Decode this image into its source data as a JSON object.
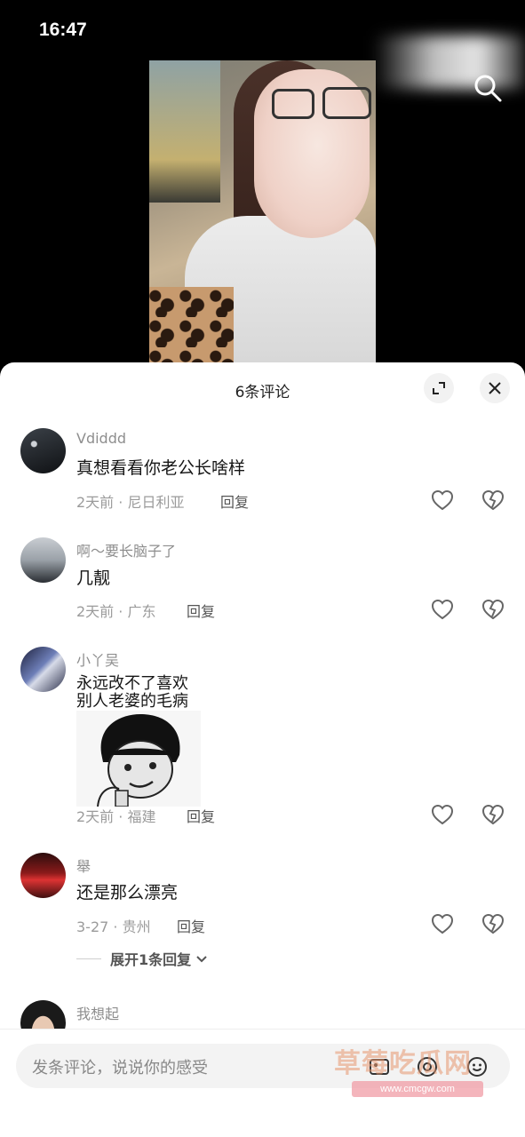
{
  "status_bar": {
    "time": "16:47"
  },
  "sheet": {
    "title": "6条评论",
    "expand_icon": "expand-icon",
    "close_icon": "close-icon"
  },
  "comments": [
    {
      "user": "Vdiddd",
      "text": "真想看看你老公长啥样",
      "time": "2天前",
      "location": "尼日利亚",
      "reply": "回复"
    },
    {
      "user": "啊～要长脑子了",
      "text": "几靓",
      "time": "2天前",
      "location": "广东",
      "reply": "回复"
    },
    {
      "user": "小丫吴",
      "text_line1": "永远改不了喜欢",
      "text_line2": "别人老婆的毛病",
      "time": "2天前",
      "location": "福建",
      "reply": "回复"
    },
    {
      "user": "舉",
      "text": "还是那么漂亮",
      "time": "3-27",
      "location": "贵州",
      "reply": "回复",
      "expand_replies": "展开1条回复"
    },
    {
      "user": "我想起"
    }
  ],
  "input_bar": {
    "placeholder": "发条评论，说说你的感受",
    "watermark": "草莓吃瓜网",
    "watermark_sub": "www.cmcgw.com"
  },
  "icons": [
    "search-icon",
    "expand-icon",
    "close-icon",
    "like-icon",
    "dislike-icon",
    "image-icon",
    "at-icon",
    "emoji-icon"
  ]
}
